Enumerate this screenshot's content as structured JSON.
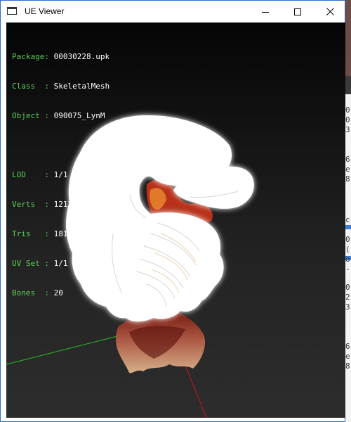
{
  "window": {
    "title": "UE Viewer",
    "app_icon": "window-app-icon",
    "controls": {
      "minimize_icon": "minimize-icon",
      "maximize_icon": "maximize-icon",
      "close_icon": "close-icon"
    }
  },
  "info_panel": {
    "asset": [
      {
        "label": "Package",
        "value": "00030228.upk"
      },
      {
        "label": "Class  ",
        "value": "SkeletalMesh"
      },
      {
        "label": "Object ",
        "value": "090075_LynM"
      }
    ],
    "stats": [
      {
        "label": "LOD    ",
        "value": "1/1"
      },
      {
        "label": "Verts  ",
        "value": "1212"
      },
      {
        "label": "Tris   ",
        "value": "1819"
      },
      {
        "label": "UV Set ",
        "value": "1/1"
      },
      {
        "label": "Bones  ",
        "value": "20"
      }
    ],
    "separator": ":"
  },
  "colors": {
    "label": "#57d057",
    "value": "#ffffff",
    "axis_x": "#d01818",
    "axis_y": "#22c022",
    "axis_z": "#3030ff",
    "mesh": "#ffffff"
  },
  "background_text": {
    "glyphs": [
      "0",
      "0",
      "3",
      "6",
      "e",
      "8",
      "c",
      "0",
      "(",
      "o",
      "-",
      "0",
      "2",
      "3",
      "6",
      "e",
      "8"
    ]
  }
}
